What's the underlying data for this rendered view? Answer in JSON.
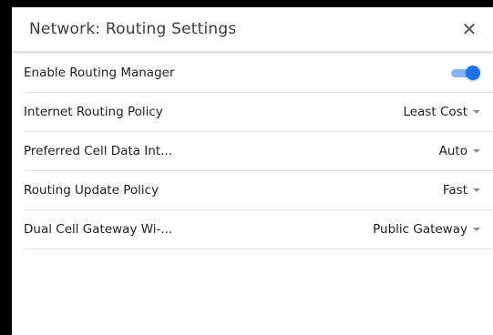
{
  "dialog": {
    "title": "Network: Routing Settings",
    "close_icon": "close-icon",
    "accent_color": "#1a73e8"
  },
  "settings": [
    {
      "label": "Enable Routing Manager",
      "control": "toggle",
      "enabled": true
    },
    {
      "label": "Internet Routing Policy",
      "control": "dropdown",
      "value": "Least Cost"
    },
    {
      "label": "Preferred Cell Data Int...",
      "control": "dropdown",
      "value": "Auto"
    },
    {
      "label": "Routing Update Policy",
      "control": "dropdown",
      "value": "Fast"
    },
    {
      "label": "Dual Cell Gateway Wi-...",
      "control": "dropdown",
      "value": "Public Gateway"
    }
  ]
}
